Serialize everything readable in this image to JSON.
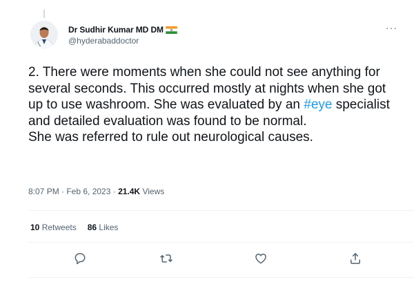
{
  "author": {
    "display_name": "Dr Sudhir Kumar MD DM",
    "handle": "@hyderabaddoctor",
    "flag_icon": "india-flag-icon"
  },
  "more_label": "···",
  "tweet": {
    "text_before": "2. There were moments when she could not see anything for several seconds. This occurred mostly at nights when she got up to use washroom. She was evaluated by an ",
    "hashtag": "#eye",
    "text_after": " specialist and detailed evaluation was found to be normal.\nShe was referred to rule out neurological causes."
  },
  "meta": {
    "time_date": "8:07 PM · Feb 6, 2023 · ",
    "views_count": "21.4K",
    "views_label": " Views"
  },
  "stats": {
    "retweets_count": "10",
    "retweets_label": " Retweets",
    "likes_count": "86",
    "likes_label": " Likes"
  },
  "actions": [
    "reply-icon",
    "retweet-icon",
    "like-icon",
    "share-icon"
  ],
  "colors": {
    "accent": "#1d9bf0",
    "secondary_text": "#536471",
    "primary_text": "#0f1419",
    "divider": "#eff3f4"
  }
}
